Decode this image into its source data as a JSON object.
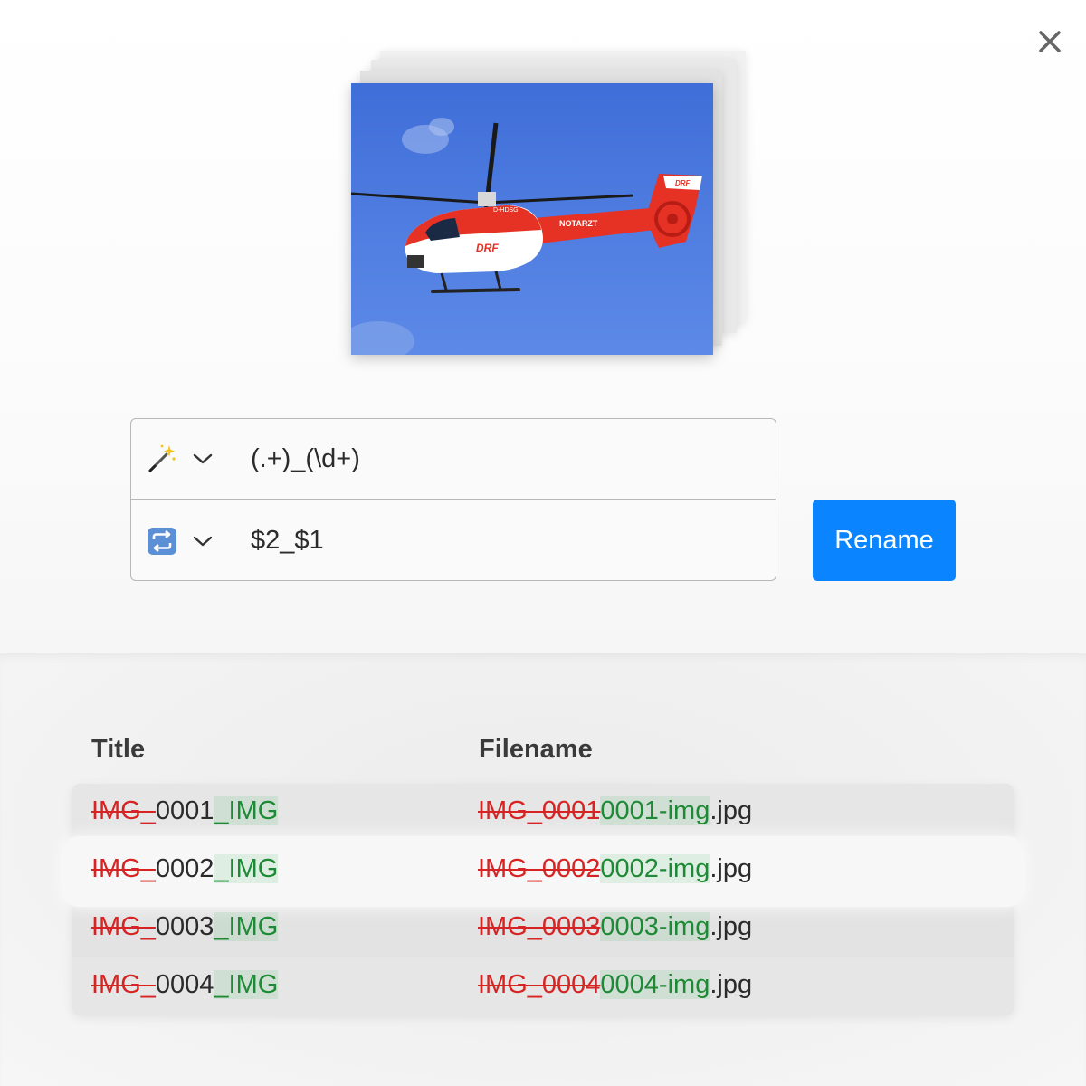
{
  "toolbar": {
    "close_icon": "close-icon"
  },
  "preview": {
    "image": "helicopter-photo",
    "rotor_text": "D-HDSG",
    "tail_logo": "DRF",
    "body_logo": "DRF",
    "tail_boom_text": "NOTARZT"
  },
  "find": {
    "icon": "magic-wand-icon",
    "value": "(.+)_(\\d+)"
  },
  "replace": {
    "icon": "repeat-icon",
    "value": "$2_$1"
  },
  "rename_button": "Rename",
  "table": {
    "headers": {
      "title": "Title",
      "filename": "Filename"
    },
    "rows": [
      {
        "title_del": "IMG_",
        "title_keep": "0001",
        "title_add": "_IMG",
        "file_del": "IMG_0001",
        "file_add": "0001-img",
        "file_ext": ".jpg"
      },
      {
        "title_del": "IMG_",
        "title_keep": "0002",
        "title_add": "_IMG",
        "file_del": "IMG_0002",
        "file_add": "0002-img",
        "file_ext": ".jpg"
      },
      {
        "title_del": "IMG_",
        "title_keep": "0003",
        "title_add": "_IMG",
        "file_del": "IMG_0003",
        "file_add": "0003-img",
        "file_ext": ".jpg"
      },
      {
        "title_del": "IMG_",
        "title_keep": "0004",
        "title_add": "_IMG",
        "file_del": "IMG_0004",
        "file_add": "0004-img",
        "file_ext": ".jpg"
      }
    ]
  },
  "colors": {
    "accent": "#0a84ff",
    "deleted": "#d62424",
    "added": "#1e8a36"
  }
}
